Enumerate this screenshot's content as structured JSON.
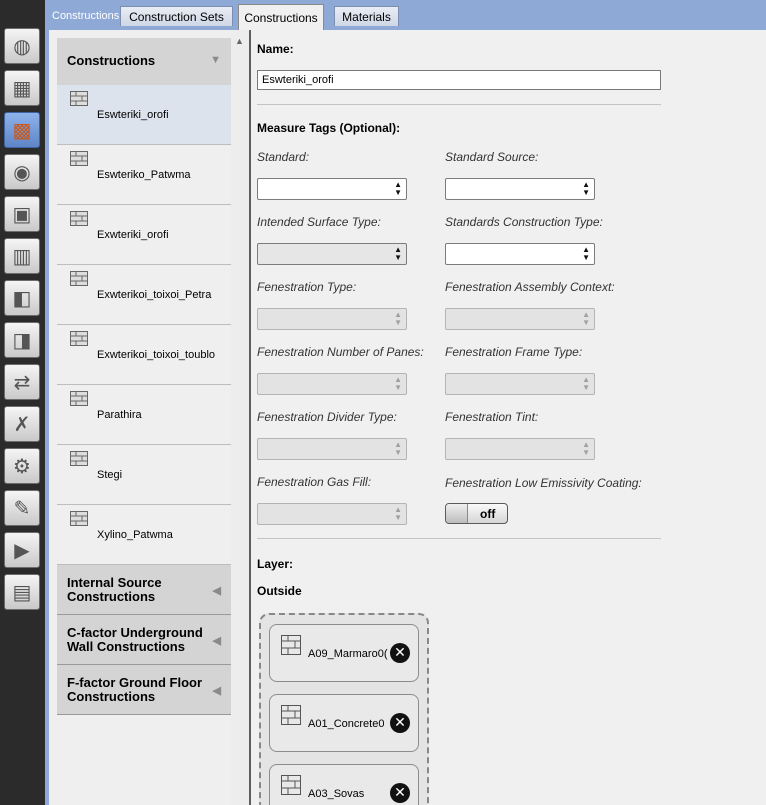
{
  "app": {
    "header_title": "Constructions"
  },
  "tabs": [
    "Construction Sets",
    "Constructions",
    "Materials"
  ],
  "toolbar": {
    "icons": [
      "globe-icon",
      "calendar-icon",
      "constructions-icon",
      "loads-icon",
      "space-types-icon",
      "building-icon",
      "geometry-icon",
      "thermal-zones-icon",
      "hvac-icon",
      "variables-icon",
      "settings-icon",
      "scripts-icon",
      "run-icon",
      "results-icon"
    ],
    "active_index": 2
  },
  "sidebar": {
    "constructions_header": "Constructions",
    "items": [
      "Eswteriki_orofi",
      "Eswteriko_Patwma",
      "Exwteriki_orofi",
      "Exwterikoi_toixoi_Petra",
      "Exwterikoi_toixoi_toublo",
      "Parathira",
      "Stegi",
      "Xylino_Patwma"
    ],
    "selected_index": 0,
    "other_groups": [
      "Internal Source Constructions",
      "C-factor Underground Wall Constructions",
      "F-factor Ground Floor Constructions"
    ]
  },
  "editor": {
    "name_label": "Name:",
    "name_value": "Eswteriki_orofi",
    "measure_tags_label": "Measure Tags (Optional):",
    "fields": {
      "standard": "Standard:",
      "standard_source": "Standard Source:",
      "intended_surface_type": "Intended Surface Type:",
      "standards_construction_type": "Standards Construction Type:",
      "fenestration_type": "Fenestration Type:",
      "fenestration_assembly_context": "Fenestration Assembly Context:",
      "fenestration_number_of_panes": "Fenestration Number of Panes:",
      "fenestration_frame_type": "Fenestration Frame Type:",
      "fenestration_divider_type": "Fenestration Divider Type:",
      "fenestration_tint": "Fenestration Tint:",
      "fenestration_gas_fill": "Fenestration Gas Fill:",
      "fenestration_low_emissivity_coating": "Fenestration Low Emissivity Coating:"
    },
    "low_e_toggle_state": "off",
    "layer_label": "Layer:",
    "outside_label": "Outside",
    "layers": [
      "A09_Marmaro0(",
      "A01_Concrete0",
      "A03_Sovas"
    ]
  }
}
